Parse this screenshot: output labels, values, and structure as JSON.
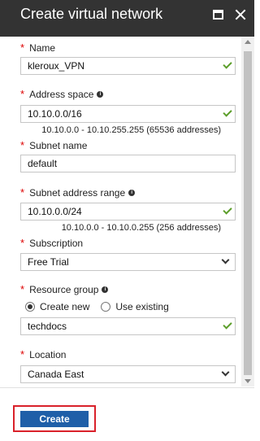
{
  "header": {
    "title": "Create virtual network"
  },
  "form": {
    "name": {
      "label": "Name",
      "value": "kleroux_VPN"
    },
    "address_space": {
      "label": "Address space",
      "value": "10.10.0.0/16",
      "hint": "10.10.0.0 - 10.10.255.255 (65536 addresses)"
    },
    "subnet_name": {
      "label": "Subnet name",
      "value": "default"
    },
    "subnet_range": {
      "label": "Subnet address range",
      "value": "10.10.0.0/24",
      "hint": "10.10.0.0 - 10.10.0.255 (256 addresses)"
    },
    "subscription": {
      "label": "Subscription",
      "value": "Free Trial"
    },
    "resource_group": {
      "label": "Resource group",
      "options": [
        "Create new",
        "Use existing"
      ],
      "selected": "Create new",
      "value": "techdocs"
    },
    "location": {
      "label": "Location",
      "value": "Canada East"
    }
  },
  "footer": {
    "create_label": "Create"
  },
  "icons": {
    "required_marker": "*",
    "info": "i"
  },
  "colors": {
    "titlebar_bg": "#333333",
    "create_button": "#1f5fa8",
    "valid_check": "#5c9e2a",
    "required": "#dd0000",
    "highlight": "#d9212a"
  }
}
